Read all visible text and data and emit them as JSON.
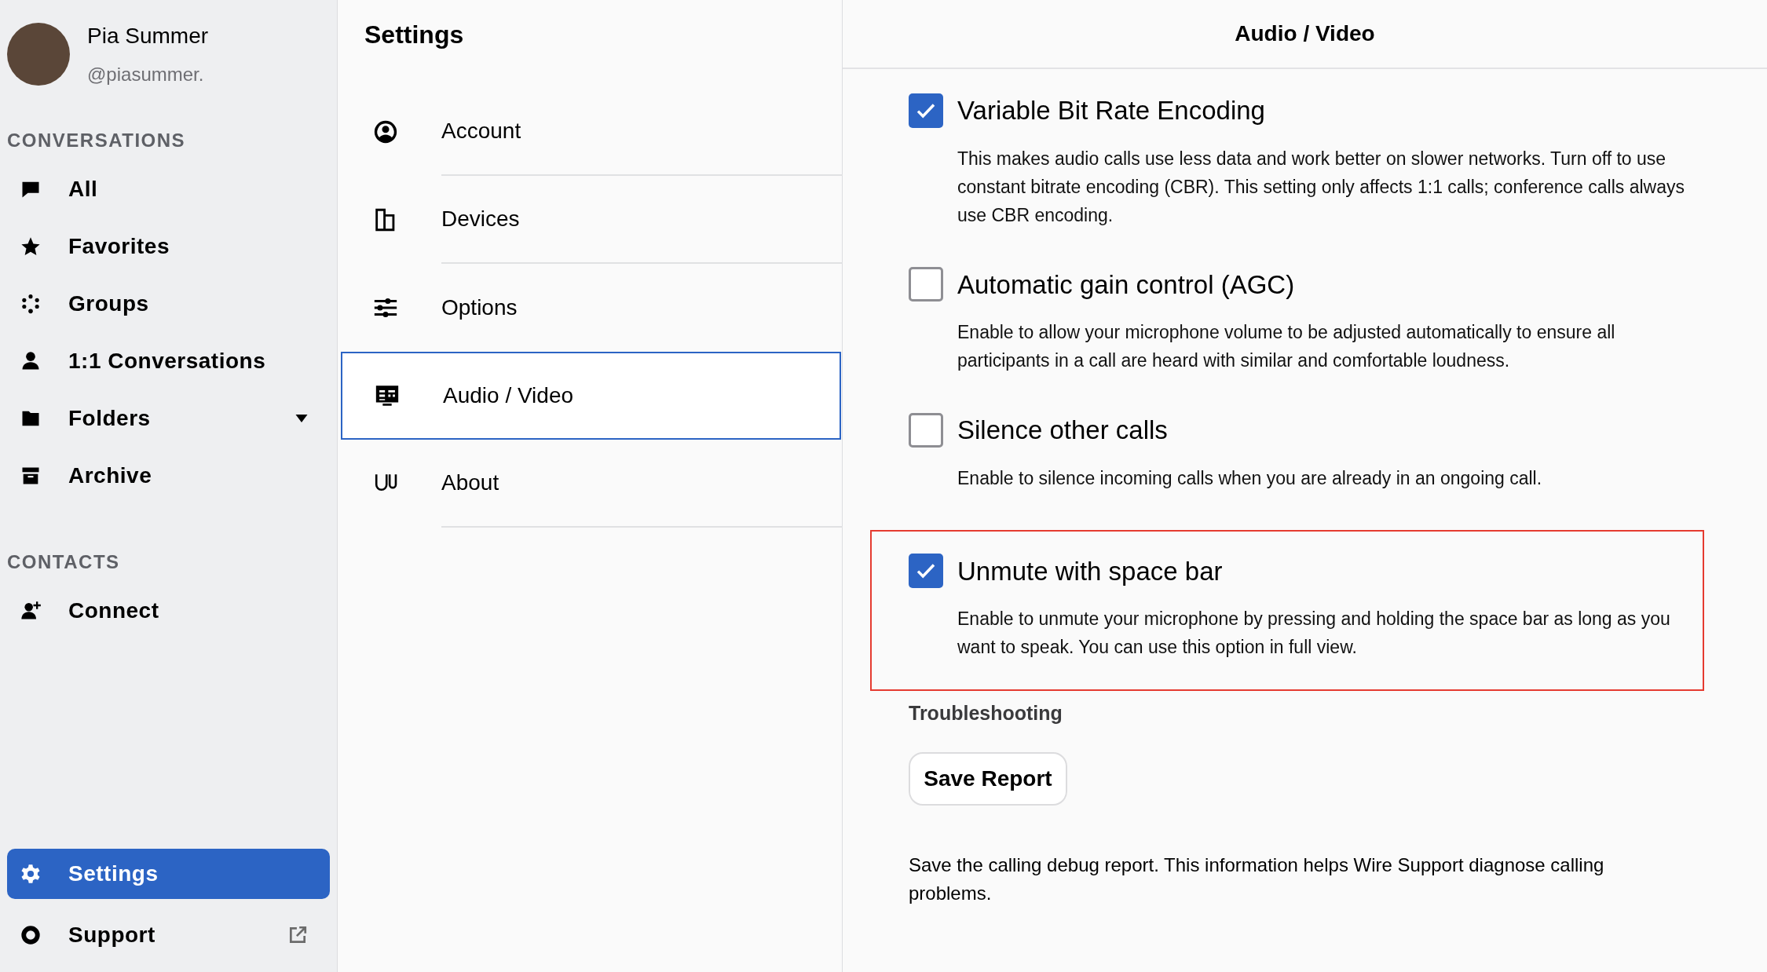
{
  "user": {
    "name": "Pia Summer",
    "handle": "@piasummer."
  },
  "sidebar": {
    "sections": [
      {
        "heading": "CONVERSATIONS",
        "items": [
          {
            "label": "All",
            "kind": "plain",
            "selected": false
          },
          {
            "label": "Favorites",
            "kind": "plain",
            "selected": false
          },
          {
            "label": "Groups",
            "kind": "plain",
            "selected": false
          },
          {
            "label": "1:1 Conversations",
            "kind": "plain",
            "selected": false
          },
          {
            "label": "Folders",
            "kind": "dropdown",
            "selected": false
          },
          {
            "label": "Archive",
            "kind": "plain",
            "selected": false
          }
        ]
      },
      {
        "heading": "CONTACTS",
        "items": [
          {
            "label": "Connect",
            "kind": "plain",
            "selected": false
          }
        ]
      }
    ],
    "footer_items": [
      {
        "label": "Settings",
        "kind": "plain",
        "selected": true
      },
      {
        "label": "Support",
        "kind": "external",
        "selected": false
      }
    ]
  },
  "settings_menu": {
    "title": "Settings",
    "items": [
      {
        "label": "Account",
        "selected": false
      },
      {
        "label": "Devices",
        "selected": false
      },
      {
        "label": "Options",
        "selected": false
      },
      {
        "label": "Audio / Video",
        "selected": true
      },
      {
        "label": "About",
        "selected": false
      }
    ]
  },
  "panel": {
    "title": "Audio / Video",
    "options": [
      {
        "title": "Variable Bit Rate Encoding",
        "description": "This makes audio calls use less data and work better on slower networks. Turn off to use constant bitrate encoding (CBR). This setting only affects 1:1 calls; conference calls always use CBR encoding.",
        "checked": true,
        "highlighted": false
      },
      {
        "title": "Automatic gain control (AGC)",
        "description": "Enable to allow your microphone volume to be adjusted automatically to ensure all participants in a call are heard with similar and comfortable loudness.",
        "checked": false,
        "highlighted": false
      },
      {
        "title": "Silence other calls",
        "description": "Enable to silence incoming calls when you are already in an ongoing call.",
        "checked": false,
        "highlighted": false
      },
      {
        "title": "Unmute with space bar",
        "description": "Enable to unmute your microphone by pressing and holding the space bar as long as you want to speak. You can use this option in full view.",
        "checked": true,
        "highlighted": true
      }
    ],
    "troubleshooting": {
      "heading": "Troubleshooting",
      "button": "Save Report",
      "note": "Save the calling debug report. This information helps Wire Support diagnose calling problems."
    }
  }
}
